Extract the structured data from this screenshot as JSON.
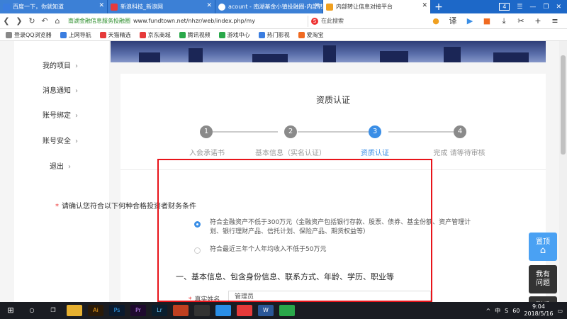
{
  "browser": {
    "tabs": [
      {
        "title": "百度一下，你就知道",
        "active": false,
        "icon_color": "#3a7de0"
      },
      {
        "title": "新浪科技_新浪网",
        "active": false,
        "icon_color": "#e63a3a"
      },
      {
        "title": "acount - 南湖基金小镇投融圈-内部转",
        "active": false,
        "icon_color": "#ffffff"
      },
      {
        "title": "内部转让信息对接平台",
        "active": true,
        "icon_color": "#f0a020"
      }
    ],
    "new_tab": "+",
    "tab_count": "4",
    "address": {
      "site_name": "南湖金融信息服务投融圈",
      "url": "www.fundtown.net/nhzr/web/index.php/my",
      "search_placeholder": "在此搜索"
    },
    "bookmarks": [
      {
        "label": "登录QQ浏览器",
        "icon_color": "#888888"
      },
      {
        "label": "上网导航",
        "icon_color": "#3a7de0"
      },
      {
        "label": "天猫精选",
        "icon_color": "#e63a3a"
      },
      {
        "label": "京东商城",
        "icon_color": "#e63a3a"
      },
      {
        "label": "腾讯视频",
        "icon_color": "#2aa84a"
      },
      {
        "label": "游戏中心",
        "icon_color": "#2aa84a"
      },
      {
        "label": "热门影视",
        "icon_color": "#3a7de0"
      },
      {
        "label": "爱淘宝",
        "icon_color": "#f06a20"
      }
    ],
    "translate": "译"
  },
  "sidebar": {
    "items": [
      "我的项目",
      "消息通知",
      "账号绑定",
      "账号安全",
      "退出"
    ]
  },
  "content": {
    "title": "资质认证",
    "steps": [
      {
        "num": "1",
        "label": "入会承诺书",
        "active": false
      },
      {
        "num": "2",
        "label": "基本信息（实名认证）",
        "active": false
      },
      {
        "num": "3",
        "label": "资质认证",
        "active": true
      },
      {
        "num": "4",
        "label": "完成 请等待审核",
        "active": false
      }
    ],
    "question": "请确认您符合以下何种合格投资者财务条件",
    "options": [
      {
        "line1": "符合金融资产不低于300万元（金融资产包括银行存款、股票、债券、基金份额、资产管理计",
        "line2": "划、银行理财产品、信托计划、保险产品、期货权益等）",
        "checked": true
      },
      {
        "line1": "符合最近三年个人年均收入不低于50万元",
        "line2": "",
        "checked": false
      }
    ],
    "section_title": "一、基本信息、包含身份信息、联系方式、年龄、学历、职业等",
    "field_label": "真实姓名",
    "field_value": "管理员"
  },
  "float_buttons": {
    "top": "置顶",
    "question_l1": "我有",
    "question_l2": "问题",
    "service_l1": "联系",
    "service_l2": "客服"
  },
  "taskbar": {
    "time": "9:04",
    "date": "2018/5/16",
    "ime": "中",
    "battery": "60"
  }
}
